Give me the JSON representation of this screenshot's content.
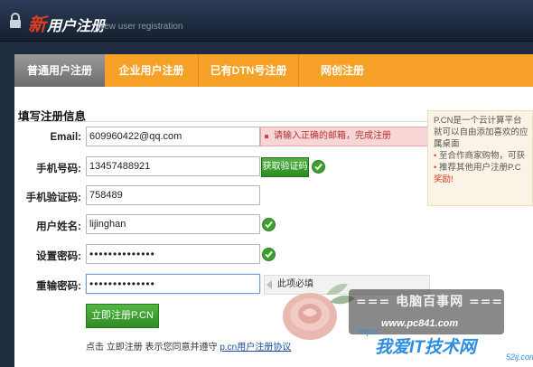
{
  "header": {
    "brand_new": "新",
    "brand_title": "用户注册",
    "brand_subtitle": "New user registration"
  },
  "tabs": [
    {
      "label": "普通用户注册",
      "active": true
    },
    {
      "label": "企业用户注册",
      "active": false
    },
    {
      "label": "已有DTN号注册",
      "active": false
    },
    {
      "label": "网创注册",
      "active": false
    }
  ],
  "form": {
    "section_title": "填写注册信息",
    "email": {
      "label": "Email:",
      "value": "609960422@qq.com",
      "error": "请输入正确的邮箱，完成注册"
    },
    "phone": {
      "label": "手机号码:",
      "value": "13457488921",
      "code_button": "获取验证码"
    },
    "phone_code": {
      "label": "手机验证码:",
      "value": "758489"
    },
    "name": {
      "label": "用户姓名:",
      "value": "lijinghan"
    },
    "password": {
      "label": "设置密码:",
      "value": "••••••••••••••"
    },
    "password_confirm": {
      "label": "重输密码:",
      "value": "••••••••••••••",
      "hint": "此项必填"
    },
    "submit_label": "立即注册P.CN",
    "terms_text": "点击 立即注册 表示您同意并遵守",
    "terms_link": "p.cn用户注册协议"
  },
  "info_box": {
    "line1": "P.CN是一个云计算平台",
    "line2": "就可以自由添加喜欢的应",
    "line3": "属桌面",
    "line4": "至合作商家购物，可获",
    "line5": "推荐其他用户注册P.C",
    "line6": "奖励!"
  },
  "watermark": {
    "title": "=== 电脑百事网 ===",
    "url": "www.pc841.com",
    "http": "http://",
    "brand": "我爱IT技术网",
    "brand_sub": "52ij.com"
  },
  "colors": {
    "accent_orange": "#f7a128",
    "success_green": "#3ca02e",
    "error_red": "#b23232",
    "header_dark": "#1f2c3f"
  }
}
